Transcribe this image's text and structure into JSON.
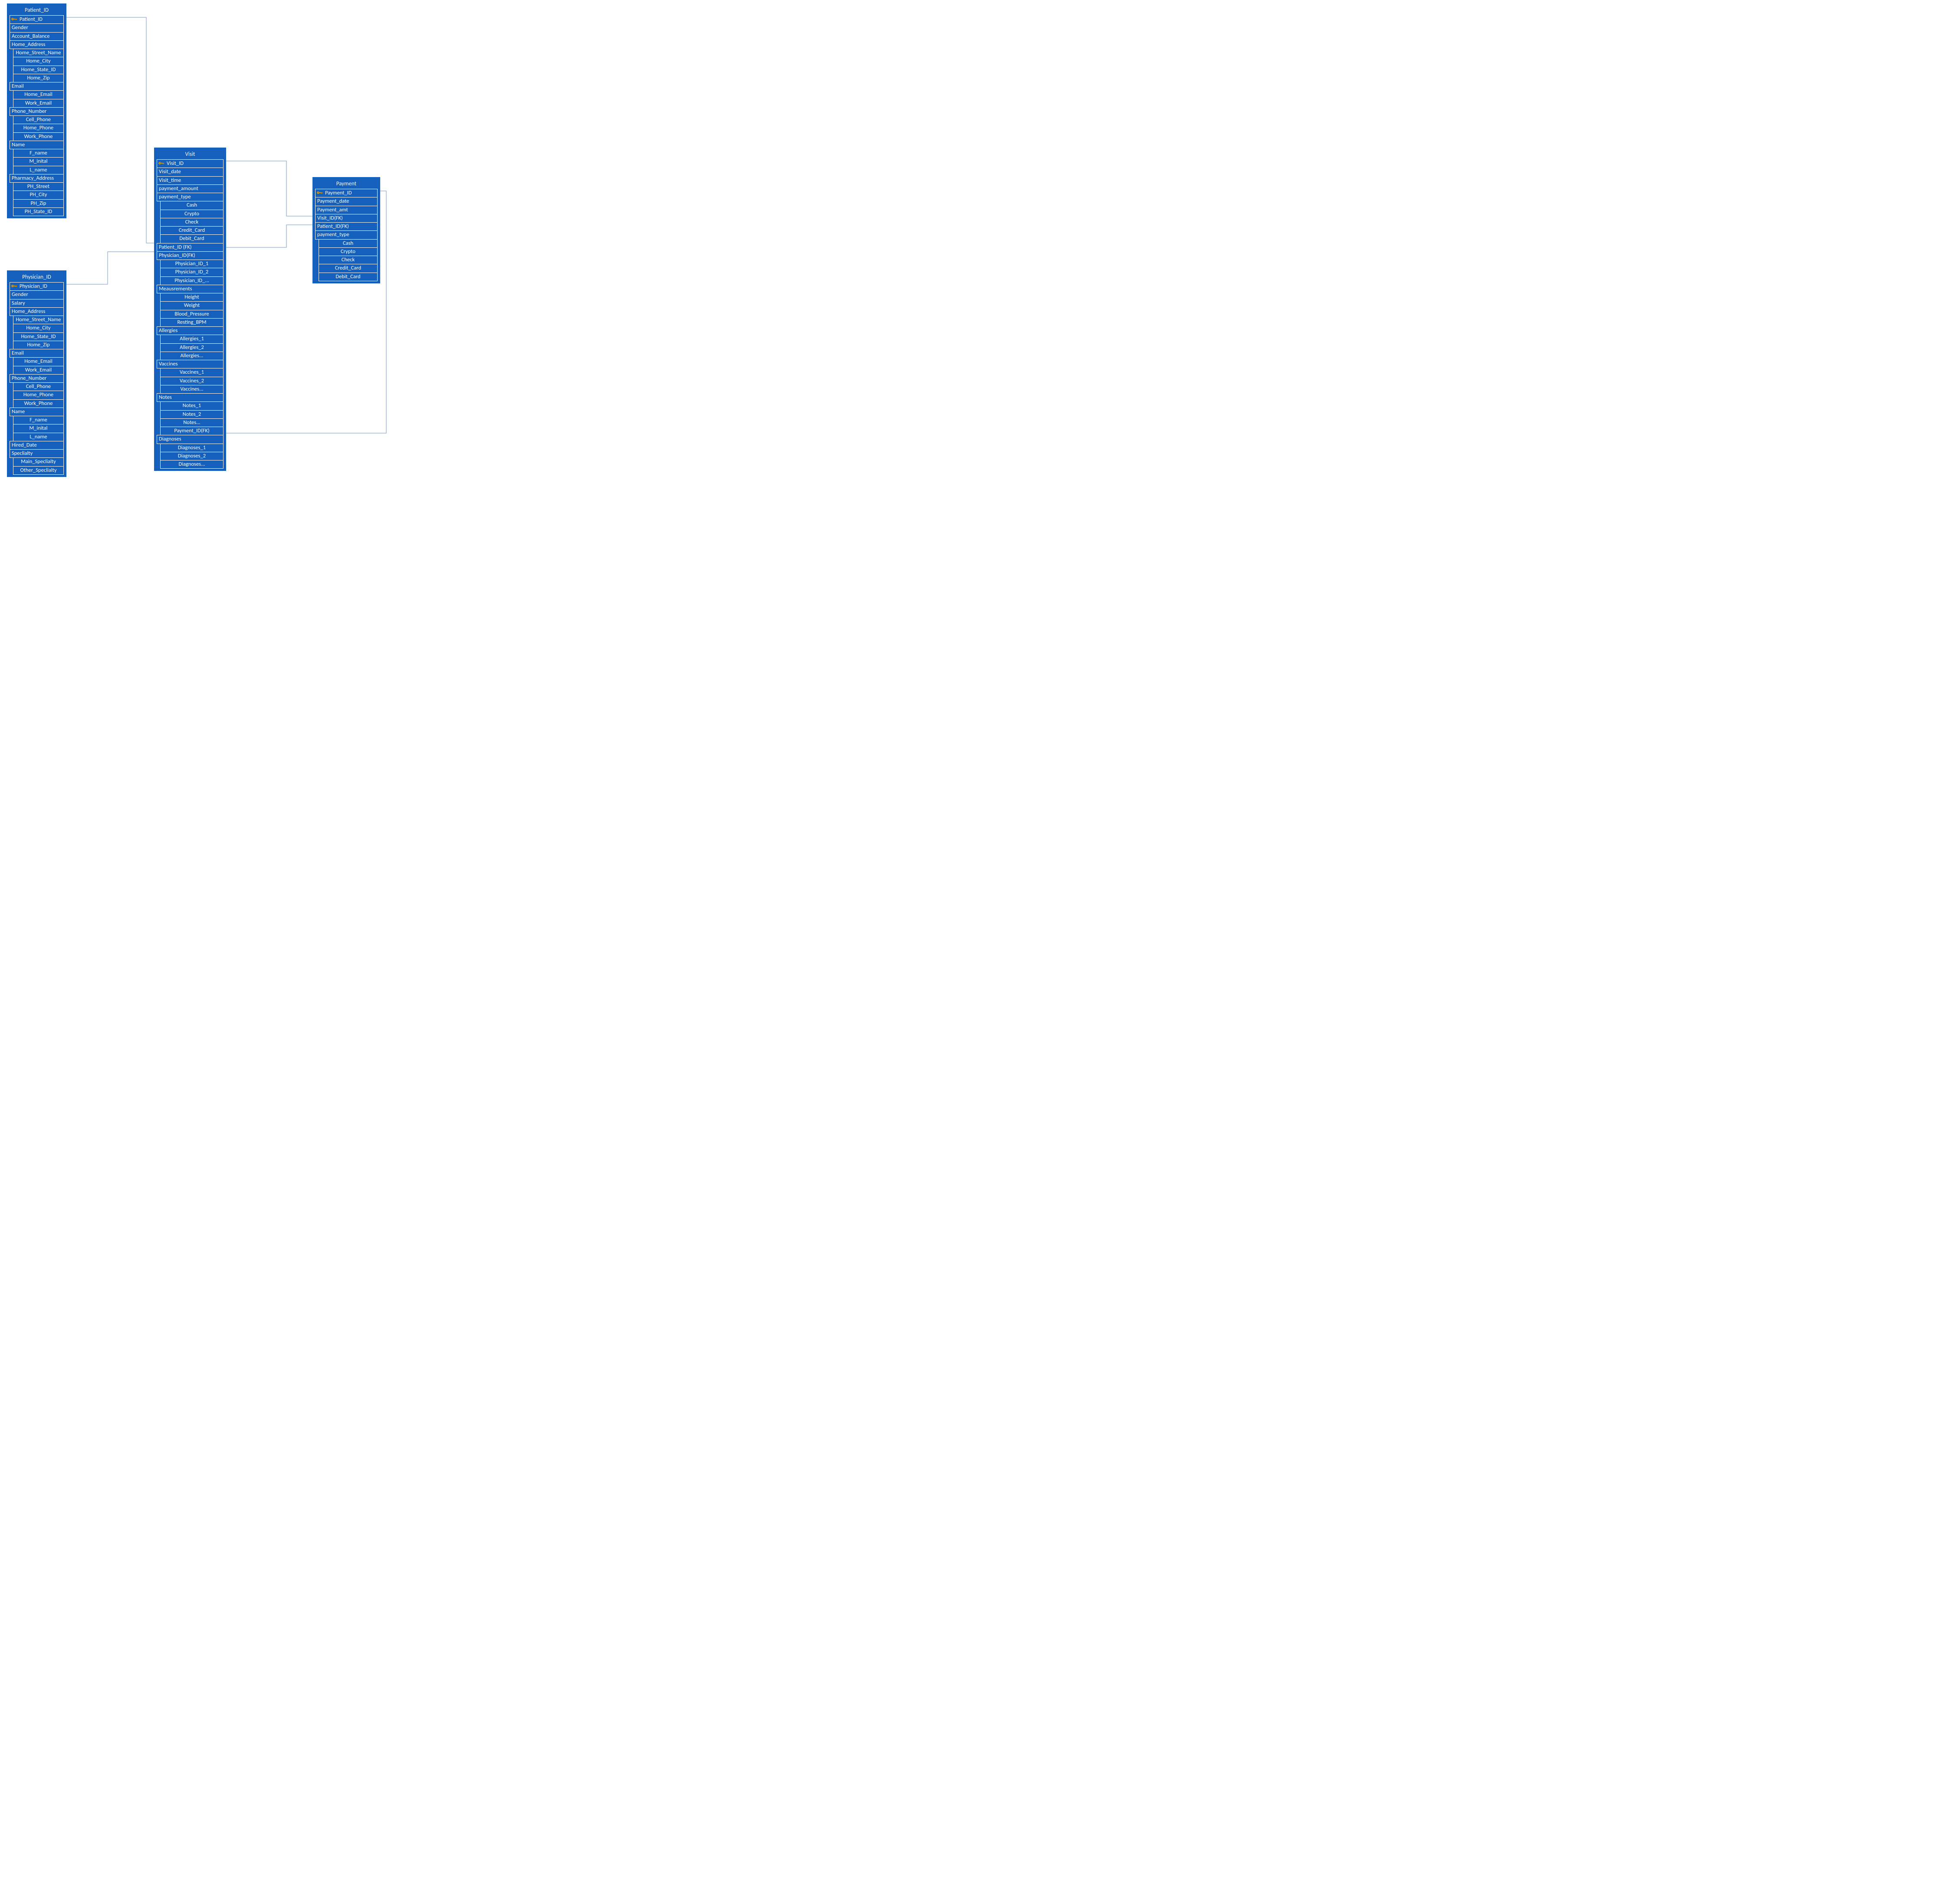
{
  "colors": {
    "entity_fill": "#1560bd",
    "cell_border": "#ffffff",
    "connector": "#7a93c4",
    "key_icon": "#f2b100"
  },
  "entities": {
    "patient": {
      "title": "Patient_ID",
      "rows": [
        {
          "label": "Patient_ID",
          "key": true
        },
        {
          "label": "Gender"
        },
        {
          "label": "Account_Balance"
        },
        {
          "label": "Home_Address"
        },
        {
          "label": "Home_Street_Name",
          "indent": 1
        },
        {
          "label": "Home_City",
          "indent": 1
        },
        {
          "label": "Home_State_ID",
          "indent": 1
        },
        {
          "label": "Home_Zip",
          "indent": 1
        },
        {
          "label": "Email"
        },
        {
          "label": "Home_Email",
          "indent": 1
        },
        {
          "label": "Work_Email",
          "indent": 1
        },
        {
          "label": "Phone_Number"
        },
        {
          "label": "Cell_Phone",
          "indent": 1
        },
        {
          "label": "Home_Phone",
          "indent": 1
        },
        {
          "label": "Work_Phone",
          "indent": 1
        },
        {
          "label": "Name"
        },
        {
          "label": "F_name",
          "indent": 1
        },
        {
          "label": "M_inital",
          "indent": 1
        },
        {
          "label": "L_name",
          "indent": 1
        },
        {
          "label": "Pharmacy_Address"
        },
        {
          "label": "PH_Street",
          "indent": 1
        },
        {
          "label": "PH_City",
          "indent": 1
        },
        {
          "label": "PH_Zip",
          "indent": 1
        },
        {
          "label": "PH_State_ID",
          "indent": 1
        }
      ]
    },
    "physician": {
      "title": "Physician_ID",
      "rows": [
        {
          "label": "Physician_ID",
          "key": true
        },
        {
          "label": "Gender"
        },
        {
          "label": "Salary"
        },
        {
          "label": "Home_Address"
        },
        {
          "label": "Home_Street_Name",
          "indent": 1
        },
        {
          "label": "Home_City",
          "indent": 1
        },
        {
          "label": "Home_State_ID",
          "indent": 1
        },
        {
          "label": "Home_Zip",
          "indent": 1
        },
        {
          "label": "Email"
        },
        {
          "label": "Home_Email",
          "indent": 1
        },
        {
          "label": "Work_Email",
          "indent": 1
        },
        {
          "label": "Phone_Number"
        },
        {
          "label": "Cell_Phone",
          "indent": 1
        },
        {
          "label": "Home_Phone",
          "indent": 1
        },
        {
          "label": "Work_Phone",
          "indent": 1
        },
        {
          "label": "Name"
        },
        {
          "label": "F_name",
          "indent": 1
        },
        {
          "label": "M_inital",
          "indent": 1
        },
        {
          "label": "L_name",
          "indent": 1
        },
        {
          "label": "Hired_Date"
        },
        {
          "label": "Speclialty"
        },
        {
          "label": "Main_Speclialty",
          "indent": 1
        },
        {
          "label": "Other_Speclialty",
          "indent": 1
        }
      ]
    },
    "visit": {
      "title": "Visit",
      "rows": [
        {
          "label": "Visit_ID",
          "key": true
        },
        {
          "label": "Visit_date"
        },
        {
          "label": "Visit_time"
        },
        {
          "label": "payment_amount"
        },
        {
          "label": "payment_type"
        },
        {
          "label": "Cash",
          "indent": 1
        },
        {
          "label": "Crypto",
          "indent": 1
        },
        {
          "label": "Check",
          "indent": 1
        },
        {
          "label": "Credit_Card",
          "indent": 1
        },
        {
          "label": "Debit_Card",
          "indent": 1
        },
        {
          "label": "Patient_ID (FK)"
        },
        {
          "label": "Physician_ID(FK)"
        },
        {
          "label": "Physician_ID_1",
          "indent": 1
        },
        {
          "label": "Physician_ID_2",
          "indent": 1
        },
        {
          "label": "Physician_ID_...",
          "indent": 1
        },
        {
          "label": "Meausrements"
        },
        {
          "label": "Height",
          "indent": 1
        },
        {
          "label": "Weight",
          "indent": 1
        },
        {
          "label": "Blood_Pressure",
          "indent": 1
        },
        {
          "label": "Resting_BPM",
          "indent": 1
        },
        {
          "label": "Allergies"
        },
        {
          "label": "Allergies_1",
          "indent": 1
        },
        {
          "label": "Allergies_2",
          "indent": 1
        },
        {
          "label": "Allergies...",
          "indent": 1
        },
        {
          "label": "Vaccines"
        },
        {
          "label": "Vaccines_1",
          "indent": 1
        },
        {
          "label": "Vaccines_2",
          "indent": 1
        },
        {
          "label": "Vaccines...",
          "indent": 1
        },
        {
          "label": "Notes"
        },
        {
          "label": "Notes_1",
          "indent": 1
        },
        {
          "label": "Notes_2",
          "indent": 1
        },
        {
          "label": "Notes...",
          "indent": 1
        },
        {
          "label": "Payment_ID(FK)",
          "indent": 1
        },
        {
          "label": "Diagnoses"
        },
        {
          "label": "Diagnoses_1",
          "indent": 1
        },
        {
          "label": "Diagnoses_2",
          "indent": 1
        },
        {
          "label": "Diagnoses...",
          "indent": 1
        }
      ]
    },
    "payment": {
      "title": "Payment",
      "rows": [
        {
          "label": "Payment_ID",
          "key": true
        },
        {
          "label": "Payment_date"
        },
        {
          "label": "Payment_amt"
        },
        {
          "label": "Visit_ID(FK)"
        },
        {
          "label": "Patient_ID(FK)"
        },
        {
          "label": "payment_type"
        },
        {
          "label": "Cash",
          "indent": 1
        },
        {
          "label": "Crypto",
          "indent": 1
        },
        {
          "label": "Check",
          "indent": 1
        },
        {
          "label": "Credit_Card",
          "indent": 1
        },
        {
          "label": "Debit_Card",
          "indent": 1
        }
      ]
    }
  }
}
